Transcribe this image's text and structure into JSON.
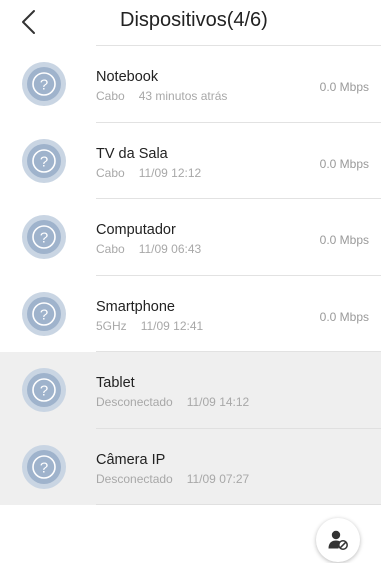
{
  "header": {
    "title": "Dispositivos(4/6)",
    "back_icon": "chevron-left-icon"
  },
  "devices": [
    {
      "name": "Notebook",
      "connection": "Cabo",
      "time": "43 minutos atrás",
      "speed": "0.0 Mbps",
      "online": true
    },
    {
      "name": "TV da Sala",
      "connection": "Cabo",
      "time": "11/09 12:12",
      "speed": "0.0 Mbps",
      "online": true
    },
    {
      "name": "Computador",
      "connection": "Cabo",
      "time": "11/09 06:43",
      "speed": "0.0 Mbps",
      "online": true
    },
    {
      "name": "Smartphone",
      "connection": "5GHz",
      "time": "11/09 12:41",
      "speed": "0.0 Mbps",
      "online": true
    },
    {
      "name": "Tablet",
      "connection": "Desconectado",
      "time": "11/09 14:12",
      "speed": "",
      "online": false
    },
    {
      "name": "Câmera IP",
      "connection": "Desconectado",
      "time": "11/09 07:27",
      "speed": "",
      "online": false
    }
  ],
  "icons": {
    "device": "unknown-device-icon",
    "fab": "blocked-user-icon"
  },
  "colors": {
    "avatar_ring": "#c9d5e3",
    "avatar_fill": "#9fb3cc",
    "offline_row": "#efefef",
    "secondary_text": "#a8a8a8"
  }
}
